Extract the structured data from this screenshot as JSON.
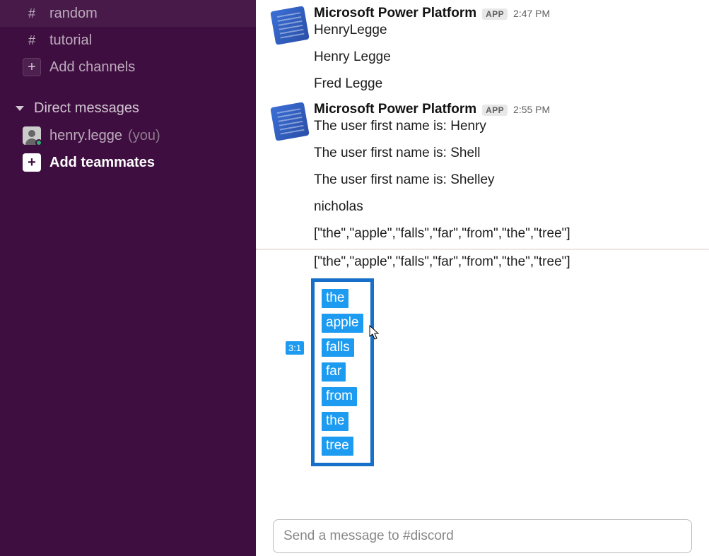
{
  "sidebar": {
    "channels": [
      {
        "name": "random"
      },
      {
        "name": "tutorial"
      }
    ],
    "add_channels_label": "Add channels",
    "dm_header": "Direct messages",
    "dm_user": {
      "name": "henry.legge",
      "you_suffix": "(you)"
    },
    "add_teammates_label": "Add teammates"
  },
  "messages": {
    "group1": {
      "sender": "Microsoft Power Platform",
      "badge": "APP",
      "time": "2:47 PM",
      "lines": [
        "HenryLegge",
        "Henry Legge",
        "Fred Legge"
      ]
    },
    "group2": {
      "sender": "Microsoft Power Platform",
      "badge": "APP",
      "time": "2:55 PM",
      "lines": [
        "The user first name is: Henry",
        "The user first name is: Shell",
        "The user first name is: Shelley",
        "nicholas",
        "[\"the\",\"apple\",\"falls\",\"far\",\"from\",\"the\",\"tree\"]",
        "[\"the\",\"apple\",\"falls\",\"far\",\"from\",\"the\",\"tree\"]"
      ],
      "hover_time": "3:1",
      "selected_words": [
        "the",
        "apple",
        "falls",
        "far",
        "from",
        "the",
        "tree"
      ]
    }
  },
  "composer": {
    "placeholder": "Send a message to #discord"
  }
}
